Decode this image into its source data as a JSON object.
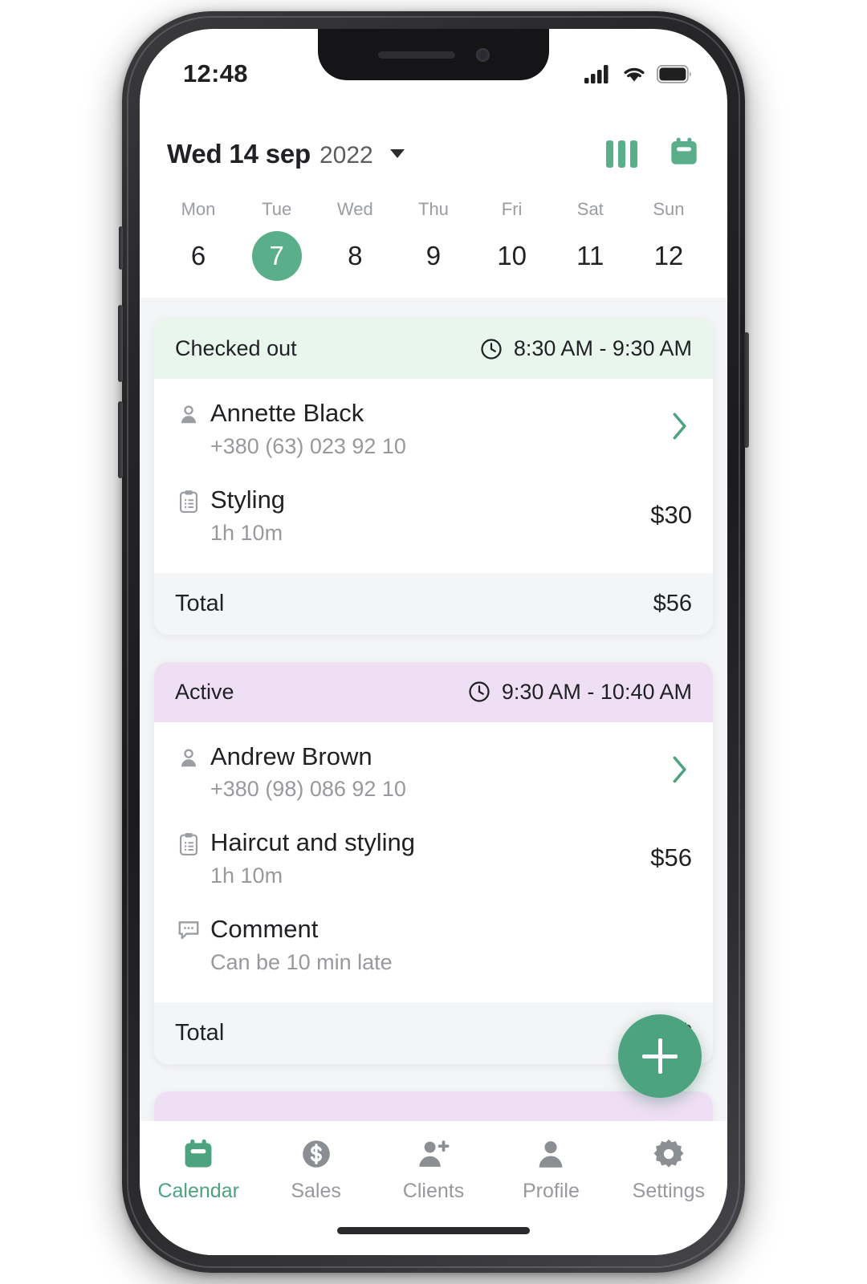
{
  "status_bar": {
    "time": "12:48",
    "icons": [
      "cellular-signal-icon",
      "wifi-icon",
      "battery-icon"
    ]
  },
  "header": {
    "date_main": "Wed 14 sep",
    "date_year": "2022",
    "dropdown_icon": "chevron-down-icon",
    "actions": [
      {
        "name": "columns-view-icon",
        "label": "Columns view"
      },
      {
        "name": "calendar-icon",
        "label": "Calendar"
      }
    ]
  },
  "week_strip": {
    "days": [
      {
        "name": "Mon",
        "num": "6",
        "selected": false
      },
      {
        "name": "Tue",
        "num": "7",
        "selected": true
      },
      {
        "name": "Wed",
        "num": "8",
        "selected": false
      },
      {
        "name": "Thu",
        "num": "9",
        "selected": false
      },
      {
        "name": "Fri",
        "num": "10",
        "selected": false
      },
      {
        "name": "Sat",
        "num": "11",
        "selected": false
      },
      {
        "name": "Sun",
        "num": "12",
        "selected": false
      }
    ]
  },
  "appointments": [
    {
      "status": "Checked out",
      "status_kind": "checked",
      "time": "8:30 AM - 9:30 AM",
      "client_name": "Annette Black",
      "client_phone": "+380 (63) 023 92 10",
      "service_name": "Styling",
      "service_duration": "1h 10m",
      "service_price": "$30",
      "total_label": "Total",
      "total_value": "$56"
    },
    {
      "status": "Active",
      "status_kind": "active",
      "time": "9:30 AM - 10:40 AM",
      "client_name": "Andrew Brown",
      "client_phone": "+380 (98) 086 92 10",
      "service_name": "Haircut and styling",
      "service_duration": "1h 10m",
      "service_price": "$56",
      "comment_label": "Comment",
      "comment_text": "Can be 10 min late",
      "total_label": "Total",
      "total_value": "$"
    }
  ],
  "fab": {
    "label": "+",
    "name": "add-appointment-button"
  },
  "bottom_nav": {
    "items": [
      {
        "label": "Calendar",
        "icon": "calendar-icon",
        "active": true
      },
      {
        "label": "Sales",
        "icon": "dollar-coin-icon",
        "active": false
      },
      {
        "label": "Clients",
        "icon": "add-person-icon",
        "active": false
      },
      {
        "label": "Profile",
        "icon": "person-icon",
        "active": false
      },
      {
        "label": "Settings",
        "icon": "gear-icon",
        "active": false
      }
    ]
  },
  "colors": {
    "accent_green": "#5aaf8a",
    "fab_green": "#4da37f",
    "checked_header_bg": "#e9f6ee",
    "active_header_bg": "#efdff4",
    "page_bg": "#f4f5f7",
    "text_primary": "#1f2124",
    "text_muted": "#97999d"
  }
}
